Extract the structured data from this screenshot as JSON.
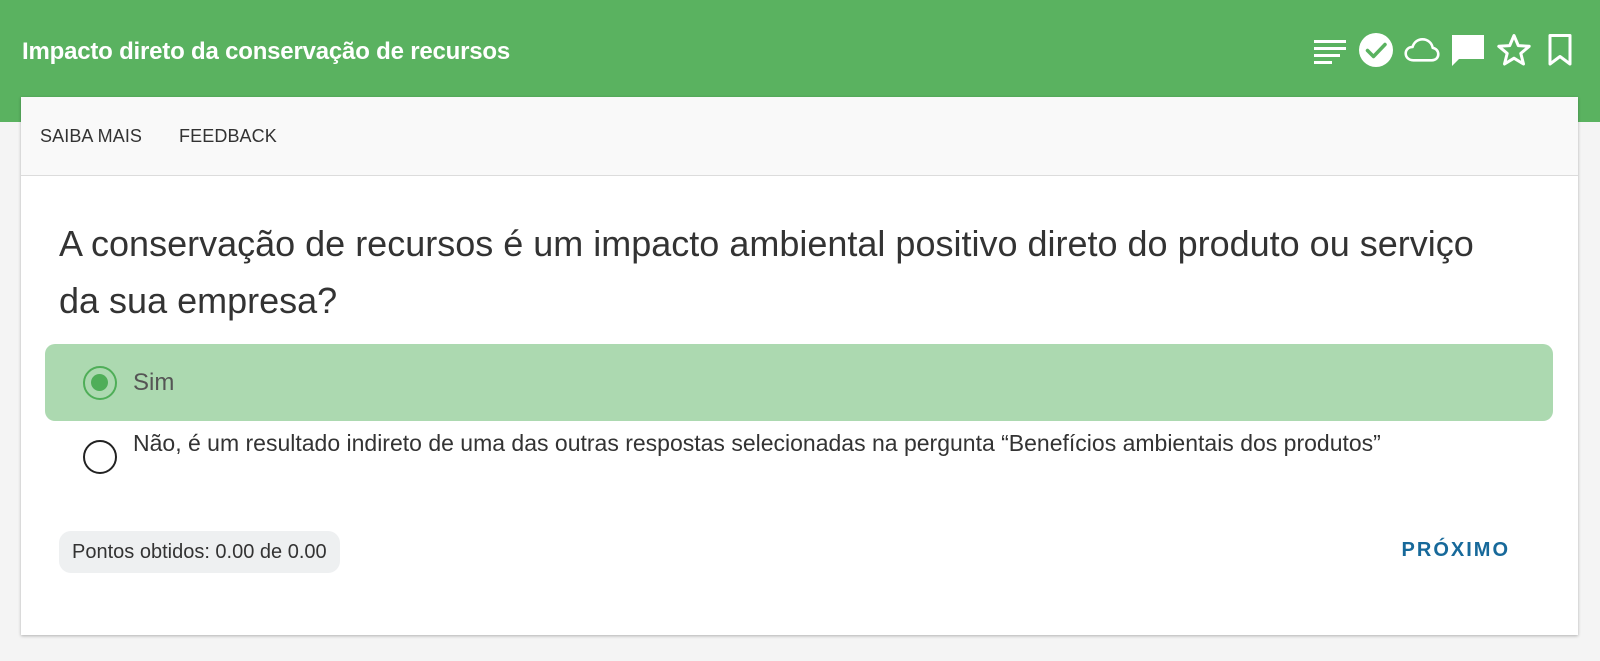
{
  "header": {
    "title": "Impacto direto da conservação de recursos",
    "background_color": "#5ab260",
    "icons": [
      "menu-lines-icon",
      "check-circle-icon",
      "cloud-icon",
      "comment-icon",
      "star-outline-icon",
      "bookmark-outline-icon"
    ]
  },
  "tabs": [
    {
      "label": "SAIBA MAIS"
    },
    {
      "label": "FEEDBACK"
    }
  ],
  "question": {
    "text": "A conservação de recursos é um impacto ambiental positivo direto do produto ou serviço da sua empresa?"
  },
  "options": [
    {
      "label": "Sim",
      "selected": true,
      "highlight_color": "#acd9b0"
    },
    {
      "label": "Não, é um resultado indireto de uma das outras respostas selecionadas na pergunta “Benefícios ambientais dos produtos”",
      "selected": false
    }
  ],
  "footer": {
    "points_text": "Pontos obtidos: 0.00 de 0.00",
    "next_label": "PRÓXIMO",
    "next_color": "#17699a"
  }
}
